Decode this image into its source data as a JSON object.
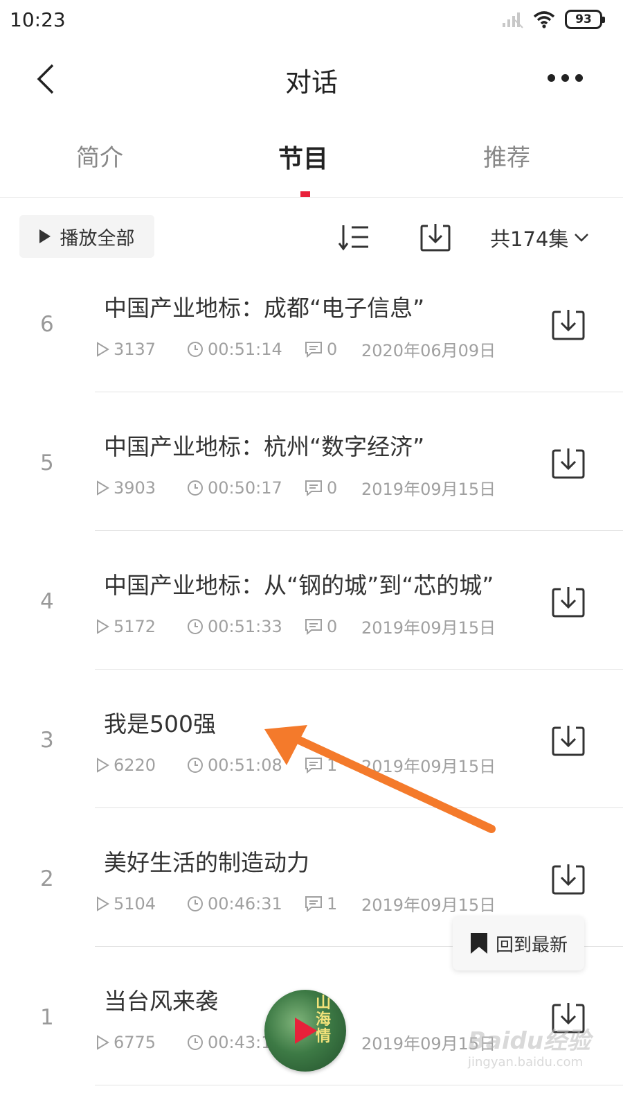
{
  "status_bar": {
    "time": "10:23",
    "battery": "93"
  },
  "nav": {
    "title": "对话"
  },
  "tabs": [
    {
      "label": "简介",
      "active": false
    },
    {
      "label": "节目",
      "active": true
    },
    {
      "label": "推荐",
      "active": false
    }
  ],
  "toolbar": {
    "play_all_label": "播放全部",
    "episode_count": "共174集"
  },
  "episodes": [
    {
      "number": "6",
      "title": "中国产业地标：成都“电子信息”",
      "plays": "3137",
      "duration": "00:51:14",
      "comments": "0",
      "date": "2020年06月09日"
    },
    {
      "number": "5",
      "title": "中国产业地标：杭州“数字经济”",
      "plays": "3903",
      "duration": "00:50:17",
      "comments": "0",
      "date": "2019年09月15日"
    },
    {
      "number": "4",
      "title": "中国产业地标：从“钢的城”到“芯的城”",
      "plays": "5172",
      "duration": "00:51:33",
      "comments": "0",
      "date": "2019年09月15日"
    },
    {
      "number": "3",
      "title": "我是500强",
      "plays": "6220",
      "duration": "00:51:08",
      "comments": "1",
      "date": "2019年09月15日"
    },
    {
      "number": "2",
      "title": "美好生活的制造动力",
      "plays": "5104",
      "duration": "00:46:31",
      "comments": "1",
      "date": "2019年09月15日"
    },
    {
      "number": "1",
      "title": "当台风来袭",
      "plays": "6775",
      "duration": "00:43:1",
      "comments": "",
      "date": "2019年09月15日"
    }
  ],
  "floating": {
    "back_to_latest": "回到最新",
    "mini_player_poster_text": "山海情"
  },
  "watermark": {
    "logo": "Baidu经验",
    "url": "jingyan.baidu.com"
  },
  "colors": {
    "accent": "#e8213a",
    "annotation_arrow": "#f47a2b"
  },
  "icons": [
    "back-icon",
    "more-icon",
    "play-icon",
    "sort-icon",
    "download-icon",
    "chevron-down-icon",
    "clock-icon",
    "comment-icon",
    "bookmark-icon"
  ]
}
